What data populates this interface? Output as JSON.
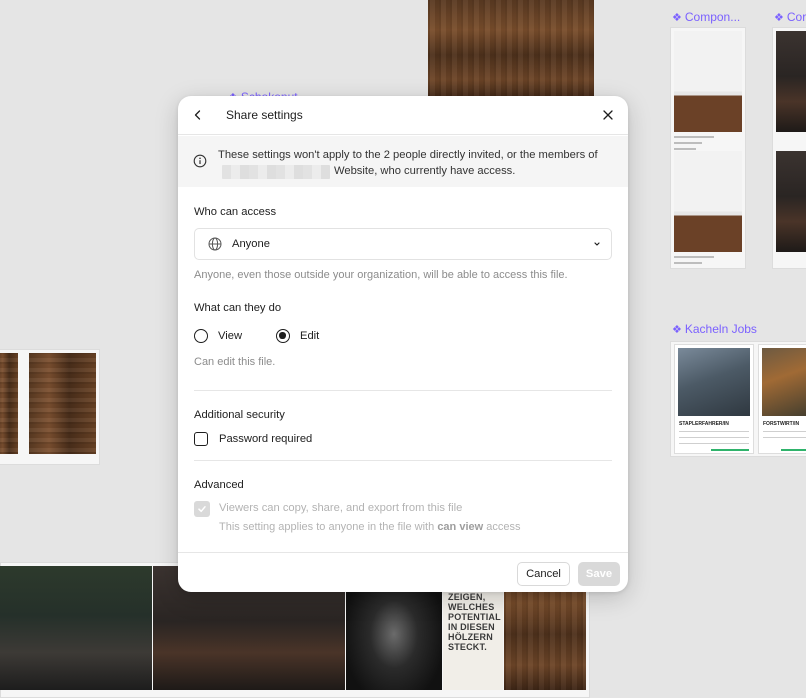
{
  "canvas": {
    "frame_labels": {
      "schokonut": "Schokonut",
      "components1": "Compon...",
      "components2": "Cor",
      "kacheln_jobs": "Kacheln Jobs"
    },
    "poster_text": "WIR WOLLTEN ZEIGEN, WELCHES POTENTIAL IN DIESEN HÖLZERN STECKT.",
    "job_cards": [
      {
        "title": "STAPLERFAHRER/IN"
      },
      {
        "title": "FORSTWIRT/IN"
      }
    ],
    "label_color": "#7b61ff"
  },
  "dialog": {
    "title": "Share settings",
    "icons": {
      "back": "chevron-left-icon",
      "close": "close-icon",
      "info": "info-icon",
      "globe": "globe-icon",
      "dropdown": "chevron-down-icon",
      "check": "check-icon"
    },
    "info": {
      "text_before": "These settings won't apply to the 2 people directly invited, or the members of",
      "text_after": "Website, who currently have access."
    },
    "who_can_access": {
      "label": "Who can access",
      "selected": "Anyone",
      "hint": "Anyone, even those outside your organization, will be able to access this file."
    },
    "what_can_they_do": {
      "label": "What can they do",
      "options": [
        {
          "label": "View",
          "selected": false
        },
        {
          "label": "Edit",
          "selected": true
        }
      ],
      "hint": "Can edit this file."
    },
    "additional_security": {
      "label": "Additional security",
      "password_label": "Password required",
      "password_checked": false
    },
    "advanced": {
      "label": "Advanced",
      "option_label": "Viewers can copy, share, and export from this file",
      "note_prefix": "This setting applies to anyone in the file with",
      "note_bold": "can view",
      "note_suffix": "access",
      "checked": true,
      "disabled": true
    },
    "footer": {
      "cancel_label": "Cancel",
      "save_label": "Save",
      "save_disabled": true
    }
  }
}
